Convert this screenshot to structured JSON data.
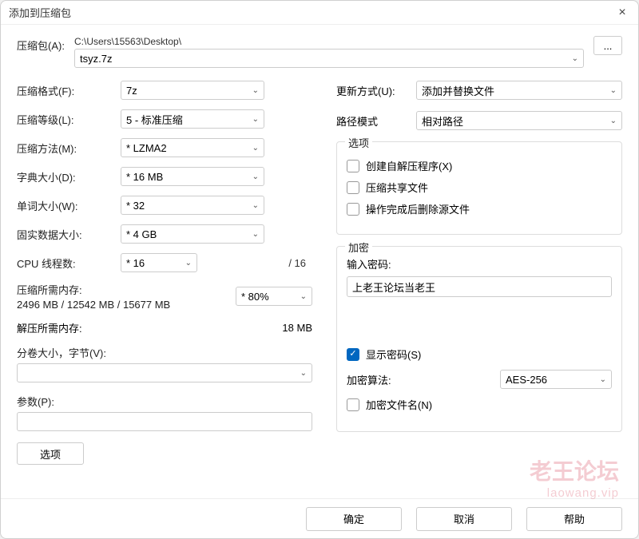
{
  "window": {
    "title": "添加到压缩包"
  },
  "archive": {
    "label": "压缩包(A):",
    "path": "C:\\Users\\15563\\Desktop\\",
    "filename": "tsyz.7z",
    "browse": "..."
  },
  "left": {
    "format": {
      "label": "压缩格式(F):",
      "value": "7z"
    },
    "level": {
      "label": "压缩等级(L):",
      "value": "5 - 标准压缩"
    },
    "method": {
      "label": "压缩方法(M):",
      "value": "* LZMA2"
    },
    "dict": {
      "label": "字典大小(D):",
      "value": "* 16 MB"
    },
    "word": {
      "label": "单词大小(W):",
      "value": "* 32"
    },
    "solid": {
      "label": "固实数据大小:",
      "value": "* 4 GB"
    },
    "threads": {
      "label": "CPU 线程数:",
      "value": "* 16",
      "total": "/ 16"
    },
    "memCompress": {
      "label": "压缩所需内存:",
      "value": "2496 MB / 12542 MB / 15677 MB",
      "pct": "* 80%"
    },
    "memDecompress": {
      "label": "解压所需内存:",
      "value": "18 MB"
    },
    "volumes": {
      "label": "分卷大小，字节(V):"
    },
    "params": {
      "label": "参数(P):"
    },
    "optionsBtn": "选项"
  },
  "right": {
    "update": {
      "label": "更新方式(U):",
      "value": "添加并替换文件"
    },
    "pathMode": {
      "label": "路径模式",
      "value": "相对路径"
    },
    "options": {
      "legend": "选项",
      "sfx": "创建自解压程序(X)",
      "shared": "压缩共享文件",
      "delete": "操作完成后删除源文件"
    },
    "encrypt": {
      "legend": "加密",
      "passLabel": "输入密码:",
      "passValue": "上老王论坛当老王",
      "showPass": "显示密码(S)",
      "methodLabel": "加密算法:",
      "methodValue": "AES-256",
      "encNames": "加密文件名(N)"
    }
  },
  "buttons": {
    "ok": "确定",
    "cancel": "取消",
    "help": "帮助"
  },
  "watermark": {
    "line1": "老王论坛",
    "line2": "laowang.vip"
  }
}
